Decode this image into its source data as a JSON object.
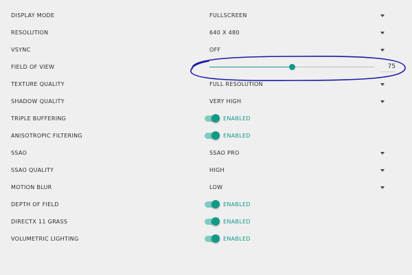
{
  "settings": [
    {
      "label": "DISPLAY MODE",
      "type": "select",
      "value": "FULLSCREEN"
    },
    {
      "label": "RESOLUTION",
      "type": "select",
      "value": "640 X 480"
    },
    {
      "label": "VSYNC",
      "type": "select",
      "value": "OFF"
    },
    {
      "label": "FIELD OF VIEW",
      "type": "slider",
      "value": "75",
      "fraction": 0.5
    },
    {
      "label": "TEXTURE QUALITY",
      "type": "select",
      "value": "FULL RESOLUTION"
    },
    {
      "label": "SHADOW QUALITY",
      "type": "select",
      "value": "VERY HIGH"
    },
    {
      "label": "TRIPLE BUFFERING",
      "type": "toggle",
      "value": "ENABLED",
      "on": true
    },
    {
      "label": "ANISOTROPIC FILTERING",
      "type": "toggle",
      "value": "ENABLED",
      "on": true
    },
    {
      "label": "SSAO",
      "type": "select",
      "value": "SSAO PRO"
    },
    {
      "label": "SSAO QUALITY",
      "type": "select",
      "value": "HIGH"
    },
    {
      "label": "MOTION BLUR",
      "type": "select",
      "value": "LOW"
    },
    {
      "label": "DEPTH OF FIELD",
      "type": "toggle",
      "value": "ENABLED",
      "on": true
    },
    {
      "label": "DIRECTX 11 GRASS",
      "type": "toggle",
      "value": "ENABLED",
      "on": true
    },
    {
      "label": "VOLUMETRIC LIGHTING",
      "type": "toggle",
      "value": "ENABLED",
      "on": true
    }
  ],
  "icons": {
    "dropdown": "chevron-down-icon",
    "toggle": "toggle-switch"
  },
  "colors": {
    "accent": "#0f9a86",
    "annotation": "#1a1aa6",
    "background": "#efefef"
  }
}
